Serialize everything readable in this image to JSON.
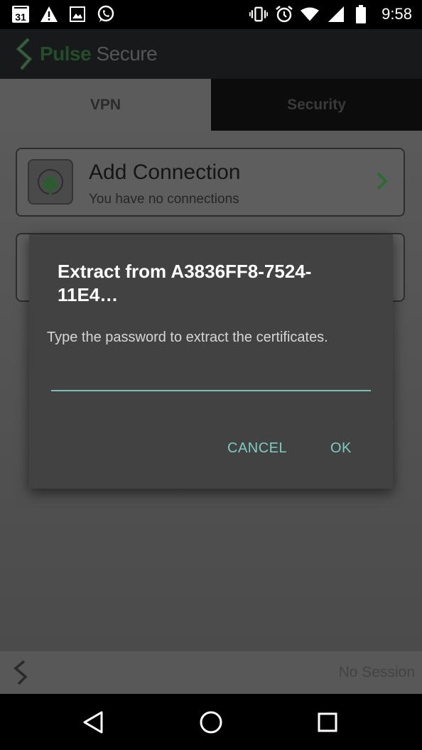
{
  "status_bar": {
    "calendar_day": "31",
    "time": "9:58",
    "left_icons": [
      "calendar-icon",
      "warning-icon",
      "image-icon",
      "whatsapp-icon"
    ],
    "right_icons": [
      "vibrate-icon",
      "alarm-icon",
      "wifi-icon",
      "signal-icon",
      "battery-icon"
    ]
  },
  "app": {
    "brand_pulse": "Pulse",
    "brand_secure": "Secure"
  },
  "tabs": [
    {
      "label": "VPN"
    },
    {
      "label": "Security"
    }
  ],
  "connection_card": {
    "title": "Add Connection",
    "subtitle": "You have no connections"
  },
  "dialog": {
    "title": "Extract from A3836FF8-7524-11E4…",
    "message": "Type the password to extract the certificates.",
    "password_value": "",
    "cancel_label": "CANCEL",
    "ok_label": "OK",
    "accent_color": "#7ecbc1"
  },
  "footer": {
    "session_status": "No Session"
  }
}
